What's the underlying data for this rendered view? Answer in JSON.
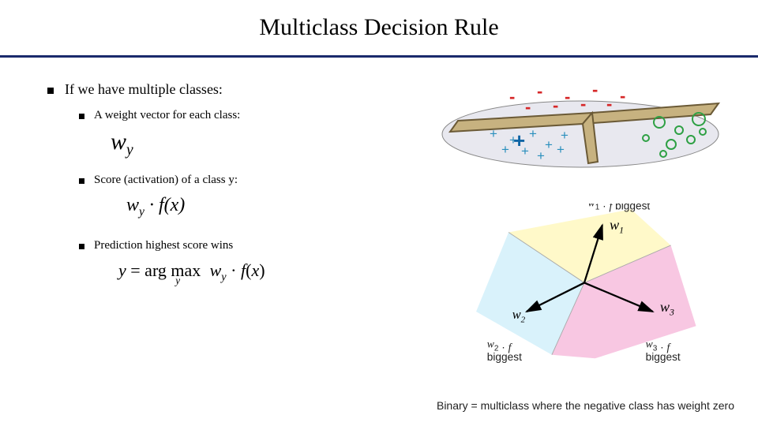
{
  "title": "Multiclass Decision Rule",
  "bullet_main": "If we have multiple classes:",
  "sub_bullets": {
    "b1": "A weight vector for each class:",
    "b2": "Score (activation) of a class y:",
    "b3": "Prediction highest score wins"
  },
  "formulas": {
    "weight_vector": "w_y",
    "score_html": "w<sub>y</sub> · f(x)",
    "prediction_html": "y = arg max<sub style='font-style:italic'>y</sub>  w<sub style='font-style:italic'>y</sub> · f(x)"
  },
  "diagram_labels": {
    "w1f": "w₁ · f",
    "biggest": "biggest",
    "w1": "w₁",
    "w2": "w₂",
    "w3": "w₃",
    "w2f": "w₂ · f",
    "w3f": "w₃ · f"
  },
  "footnote": "Binary = multiclass where the negative class has weight zero"
}
